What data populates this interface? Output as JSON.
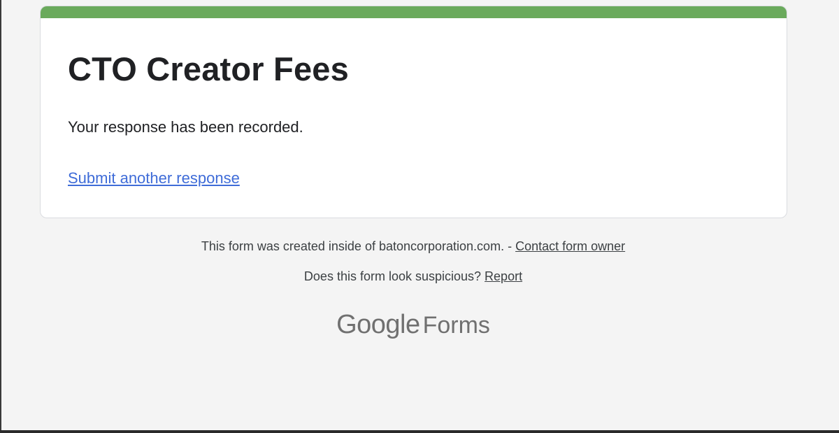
{
  "form": {
    "title": "CTO Creator Fees",
    "confirmation_message": "Your response has been recorded.",
    "submit_another_link": "Submit another response",
    "accent_color": "#6aaa5c"
  },
  "footer": {
    "created_inside_text": "This form was created inside of batoncorporation.com. -",
    "contact_owner_link": "Contact form owner",
    "suspicious_text": "Does this form look suspicious?",
    "report_link": "Report"
  },
  "logo": {
    "google": "Google",
    "forms": "Forms"
  }
}
